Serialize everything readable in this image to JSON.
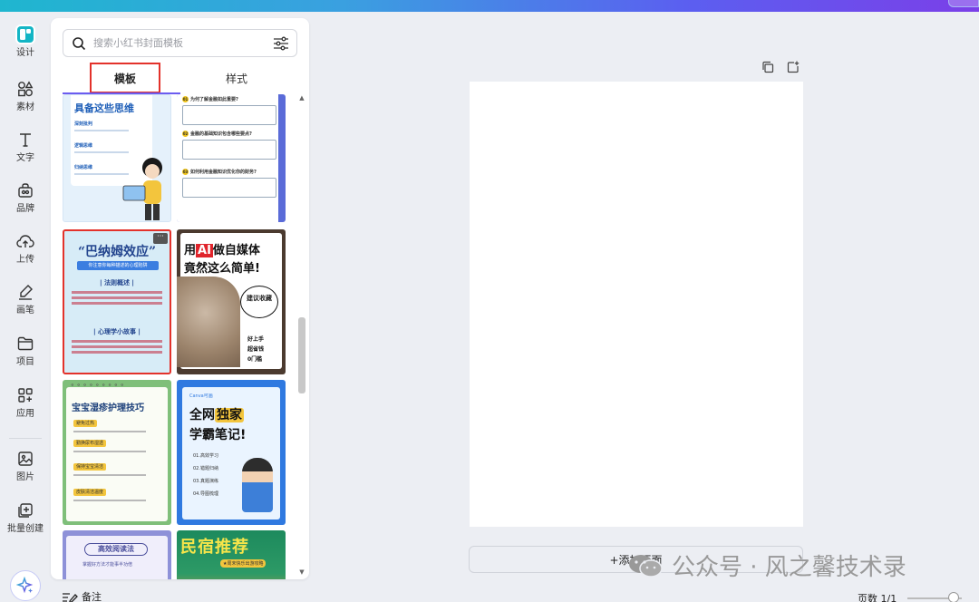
{
  "rail": {
    "items": [
      {
        "label": "设计",
        "icon": "design-icon"
      },
      {
        "label": "素材",
        "icon": "elements-icon"
      },
      {
        "label": "文字",
        "icon": "text-icon"
      },
      {
        "label": "品牌",
        "icon": "brand-icon"
      },
      {
        "label": "上传",
        "icon": "upload-icon"
      },
      {
        "label": "画笔",
        "icon": "brush-icon"
      },
      {
        "label": "项目",
        "icon": "folder-icon"
      },
      {
        "label": "应用",
        "icon": "apps-icon"
      },
      {
        "label": "图片",
        "icon": "image-icon"
      },
      {
        "label": "批量创建",
        "icon": "batch-create-icon"
      }
    ]
  },
  "panel": {
    "search_placeholder": "搜索小红书封面模板",
    "tabs": [
      {
        "label": "模板",
        "active": true
      },
      {
        "label": "样式",
        "active": false
      }
    ]
  },
  "templates": {
    "c1": {
      "title": "具备这些思维",
      "rows": [
        "深刻批判",
        "逻辑思维",
        "归纳思维"
      ]
    },
    "c2": {
      "items": [
        "为何了解金融如此重要?",
        "金融的基础知识包含哪些要点?",
        "如何利用金融知识优化你的财务?"
      ]
    },
    "c3": {
      "title": "“巴纳姆效应”",
      "subtitle": "你注意你每种描述的心理陷阱",
      "section1": "| 法则概述 |",
      "section2": "| 心理学小故事 |",
      "more": "···"
    },
    "c4": {
      "line1_a": "用",
      "line1_ai": "AI",
      "line1_b": "做自媒体",
      "line2": "竟然这么简单!",
      "bubble": "建议收藏",
      "list": [
        "好上手",
        "超省钱",
        "0门槛"
      ]
    },
    "c5": {
      "title": "宝宝湿疹护理技巧",
      "tags": [
        "避免过热",
        "勤换尿布湿透",
        "保持宝宝清洁",
        "皮肤清洁温度"
      ]
    },
    "c6": {
      "brand": "Canva可画",
      "line1_a": "全网",
      "line1_hl": "独家",
      "line2": "学霸笔记!",
      "list": [
        "01.高效学习",
        "02.错题归纳",
        "03.真题演练",
        "04.导图梳理"
      ]
    },
    "c7": {
      "title": "高效阅读法",
      "sub": "掌握好方法才能事半功倍"
    },
    "c8": {
      "title": "民宿推荐",
      "tag": "★周末快乐出游攻略"
    }
  },
  "canvas": {
    "add_page": "+添加页面"
  },
  "watermark": {
    "text": "公众号 · 风之馨技术录"
  },
  "bottom": {
    "notes": "备注",
    "pages": "页数 1/1"
  },
  "colors": {
    "accent": "#6b5cf0",
    "highlight_box": "#e3322b",
    "canvas_bg": "#ffffff",
    "app_bg": "#eceef3"
  }
}
